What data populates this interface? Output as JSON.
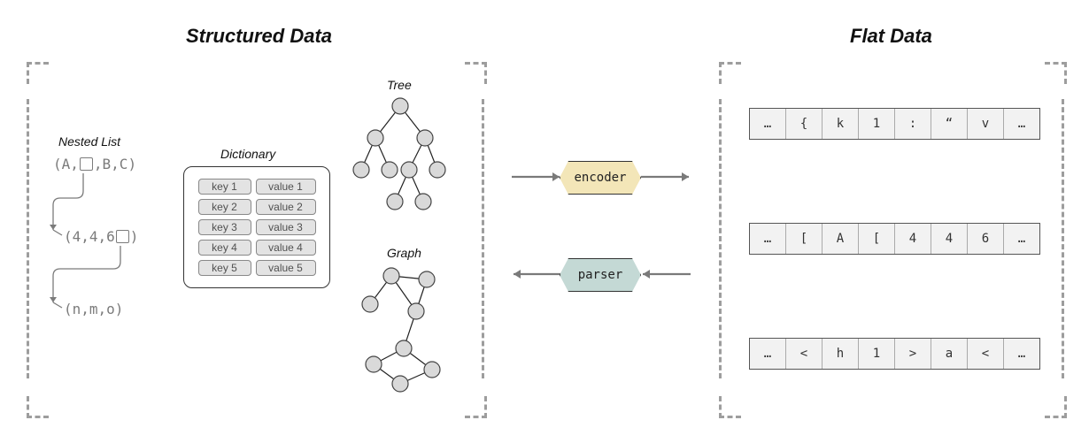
{
  "headings": {
    "structured": "Structured Data",
    "flat": "Flat Data"
  },
  "labels": {
    "nested_list": "Nested List",
    "dictionary": "Dictionary",
    "tree": "Tree",
    "graph": "Graph"
  },
  "encoder_label": "encoder",
  "parser_label": "parser",
  "nested_list": {
    "row1": {
      "pre": "(A,",
      "mid": ",B,C)",
      "has_box": true
    },
    "row2": {
      "pre": "(4,4,6",
      "mid": ")",
      "has_box": true
    },
    "row3": {
      "text": "(n,m,o)"
    }
  },
  "dictionary": {
    "rows": [
      {
        "key": "key 1",
        "value": "value 1"
      },
      {
        "key": "key 2",
        "value": "value 2"
      },
      {
        "key": "key 3",
        "value": "value 3"
      },
      {
        "key": "key 4",
        "value": "value 4"
      },
      {
        "key": "key 5",
        "value": "value 5"
      }
    ]
  },
  "token_rows": {
    "r1": [
      "…",
      "{",
      "k",
      "1",
      ":",
      "“",
      "v",
      "…"
    ],
    "r2": [
      "…",
      "[",
      "A",
      "[",
      "4",
      "4",
      "6",
      "…"
    ],
    "r3": [
      "…",
      "<",
      "h",
      "1",
      ">",
      "a",
      "<",
      "…"
    ]
  }
}
